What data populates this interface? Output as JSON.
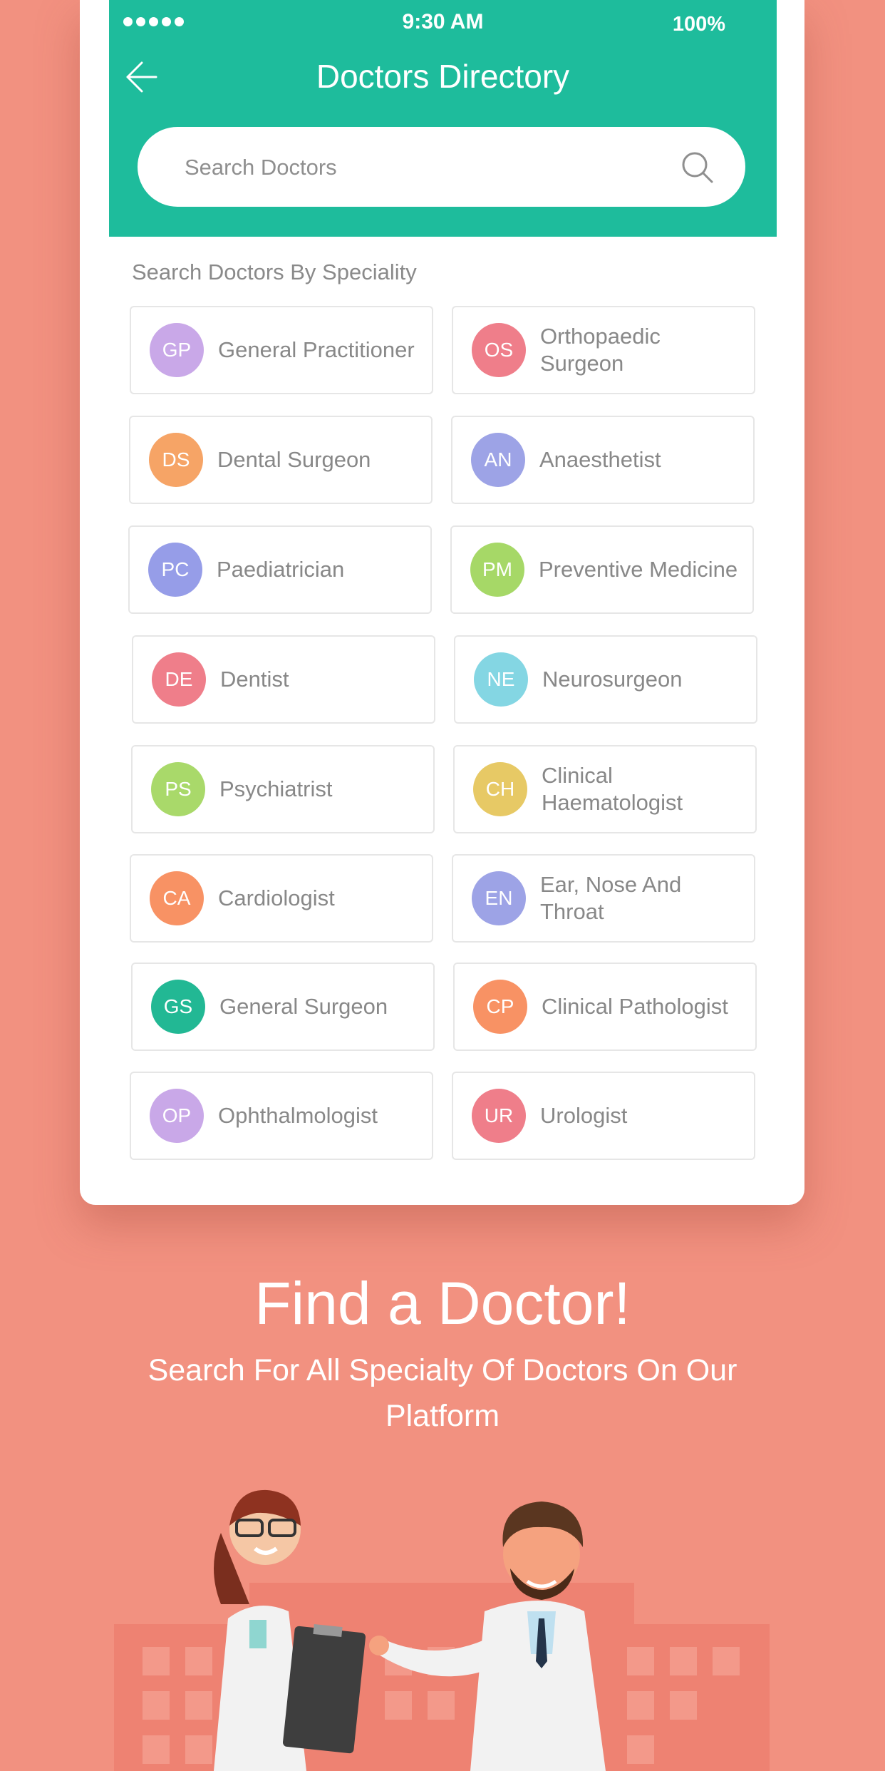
{
  "status_bar": {
    "signal_dots": 5,
    "time": "9:30 AM",
    "battery": "100%"
  },
  "header": {
    "title": "Doctors Directory",
    "back_icon": "back-arrow-icon"
  },
  "search": {
    "placeholder": "Search Doctors",
    "value": "",
    "icon": "search-icon"
  },
  "specialities": {
    "title": "Search Doctors By Speciality",
    "items": [
      {
        "abbr": "GP",
        "label": "General Practitioner",
        "color": "#C9A8E8"
      },
      {
        "abbr": "OS",
        "label": "Orthopaedic Surgeon",
        "color": "#EF7E8A"
      },
      {
        "abbr": "DS",
        "label": "Dental Surgeon",
        "color": "#F6A466"
      },
      {
        "abbr": "AN",
        "label": "Anaesthetist",
        "color": "#9DA3E6"
      },
      {
        "abbr": "PC",
        "label": "Paediatrician",
        "color": "#969DE8"
      },
      {
        "abbr": "PM",
        "label": "Preventive Medicine",
        "color": "#A6D867"
      },
      {
        "abbr": "DE",
        "label": "Dentist",
        "color": "#EF7E8A"
      },
      {
        "abbr": "NE",
        "label": "Neurosurgeon",
        "color": "#84D6E3"
      },
      {
        "abbr": "PS",
        "label": "Psychiatrist",
        "color": "#A9D96A"
      },
      {
        "abbr": "CH",
        "label": "Clinical Haematologist",
        "color": "#E7C965"
      },
      {
        "abbr": "CA",
        "label": "Cardiologist",
        "color": "#F89264"
      },
      {
        "abbr": "EN",
        "label": "Ear, Nose And Throat",
        "color": "#9DA3E6"
      },
      {
        "abbr": "GS",
        "label": "General Surgeon",
        "color": "#22B894"
      },
      {
        "abbr": "CP",
        "label": "Clinical Pathologist",
        "color": "#F89264"
      },
      {
        "abbr": "OP",
        "label": "Ophthalmologist",
        "color": "#C9A8E8"
      },
      {
        "abbr": "UR",
        "label": "Urologist",
        "color": "#EF7E8A"
      }
    ]
  },
  "promo": {
    "headline": "Find a Doctor!",
    "subline": "Search For All Specialty Of Doctors On Our Platform",
    "illustration": "two-doctors-hospital-illustration"
  },
  "colors": {
    "header": "#1EBC9C",
    "background": "#F29180",
    "card": "#FFFFFF"
  }
}
